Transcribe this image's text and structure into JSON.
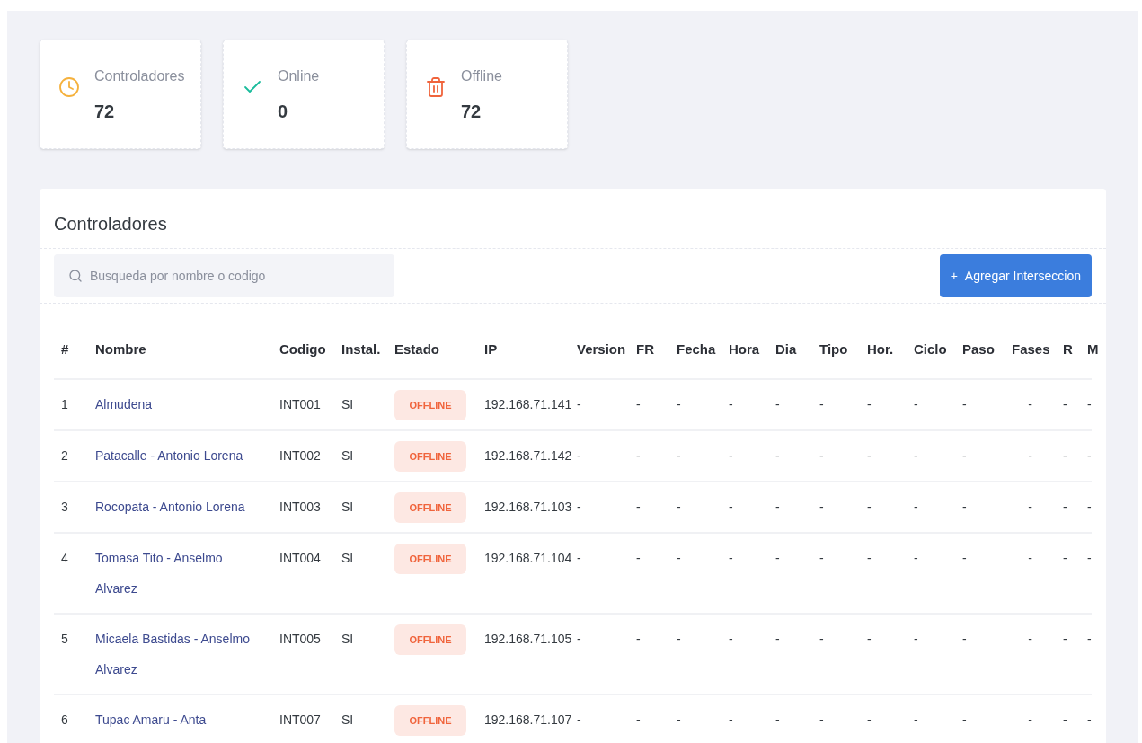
{
  "stats": [
    {
      "kind": "clock",
      "label": "Controladores",
      "value": "72"
    },
    {
      "kind": "check",
      "label": "Online",
      "value": "0"
    },
    {
      "kind": "trash",
      "label": "Offline",
      "value": "72"
    }
  ],
  "panel": {
    "title": "Controladores",
    "search": {
      "placeholder": "Busqueda por nombre o codigo"
    },
    "add_button": {
      "icon": "+",
      "label": "Agregar Interseccion"
    }
  },
  "table": {
    "columns": [
      "#",
      "Nombre",
      "Codigo",
      "Instal.",
      "Estado",
      "IP",
      "Version",
      "FR",
      "Fecha",
      "Hora",
      "Dia",
      "Tipo",
      "Hor.",
      "Ciclo",
      "Paso",
      "Fases",
      "R",
      "M"
    ],
    "rows": [
      {
        "num": "1",
        "name": "Almudena",
        "code": "INT001",
        "instal": "SI",
        "status": {
          "kind": "offline",
          "label": "OFFLINE"
        },
        "ip": "192.168.71.141",
        "values": [
          "-",
          "-",
          "-",
          "-",
          "-",
          "-",
          "-",
          "-",
          "-",
          "-",
          "-",
          "-"
        ]
      },
      {
        "num": "2",
        "name": "Patacalle - Antonio Lorena",
        "code": "INT002",
        "instal": "SI",
        "status": {
          "kind": "offline",
          "label": "OFFLINE"
        },
        "ip": "192.168.71.142",
        "values": [
          "-",
          "-",
          "-",
          "-",
          "-",
          "-",
          "-",
          "-",
          "-",
          "-",
          "-",
          "-"
        ]
      },
      {
        "num": "3",
        "name": "Rocopata - Antonio Lorena",
        "code": "INT003",
        "instal": "SI",
        "status": {
          "kind": "offline",
          "label": "OFFLINE"
        },
        "ip": "192.168.71.103",
        "values": [
          "-",
          "-",
          "-",
          "-",
          "-",
          "-",
          "-",
          "-",
          "-",
          "-",
          "-",
          "-"
        ]
      },
      {
        "num": "4",
        "name": "Tomasa Tito - Anselmo Alvarez",
        "code": "INT004",
        "instal": "SI",
        "status": {
          "kind": "offline",
          "label": "OFFLINE"
        },
        "ip": "192.168.71.104",
        "values": [
          "-",
          "-",
          "-",
          "-",
          "-",
          "-",
          "-",
          "-",
          "-",
          "-",
          "-",
          "-"
        ]
      },
      {
        "num": "5",
        "name": "Micaela Bastidas - Anselmo Alvarez",
        "code": "INT005",
        "instal": "SI",
        "status": {
          "kind": "offline",
          "label": "OFFLINE"
        },
        "ip": "192.168.71.105",
        "values": [
          "-",
          "-",
          "-",
          "-",
          "-",
          "-",
          "-",
          "-",
          "-",
          "-",
          "-",
          "-"
        ]
      },
      {
        "num": "6",
        "name": "Tupac Amaru - Anta",
        "code": "INT007",
        "instal": "SI",
        "status": {
          "kind": "offline",
          "label": "OFFLINE"
        },
        "ip": "192.168.71.107",
        "values": [
          "-",
          "-",
          "-",
          "-",
          "-",
          "-",
          "-",
          "-",
          "-",
          "-",
          "-",
          "-"
        ]
      }
    ]
  }
}
